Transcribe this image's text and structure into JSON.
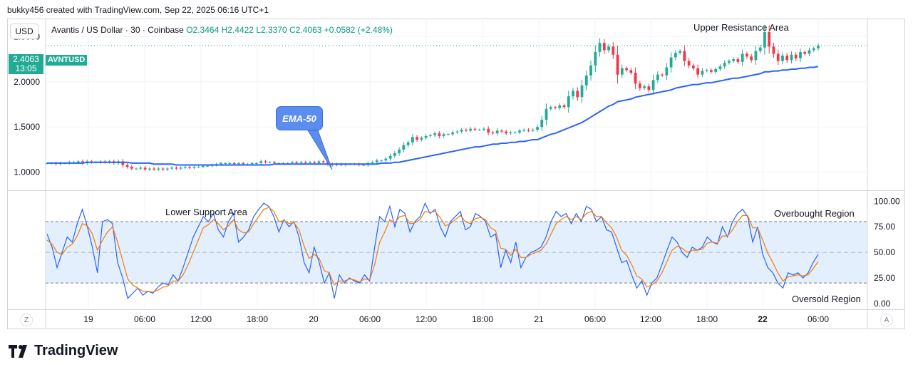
{
  "header": "bukky456 created with TradingView.com, Sep 22, 2025 06:16 UTC+1",
  "currency_button": "USD",
  "legend": {
    "symbol_desc": "Avantis / US Dollar · 30 · Coinbase",
    "open": "O2.3464",
    "high": "H2.4422",
    "low": "L2.3370",
    "close": "C2.4063",
    "change": "+0.0582 (+2.48%)"
  },
  "price_tag": {
    "value": "2.4063",
    "countdown": "13:05",
    "symbol": "AVNTUSD"
  },
  "annotations": {
    "upper": "Upper Resistance Area",
    "lower": "Lower Support Area",
    "overbought": "Overbought Region",
    "oversold": "Oversold Region",
    "ema": "EMA-50"
  },
  "corner_left": "Z",
  "corner_right": "A",
  "brand": "TradingView",
  "colors": {
    "up": "#22ab94",
    "down": "#f23645",
    "ema": "#2962ff",
    "rsi_k": "#2962ff",
    "rsi_d": "#f57c00",
    "band": "#e3effd"
  },
  "chart_data": [
    {
      "type": "candlestick",
      "ylim": [
        0.8,
        2.7
      ],
      "yticks": [
        "2.5000",
        "2.0000",
        "1.5000",
        "1.0000"
      ],
      "ytick_values": [
        2.5,
        2.0,
        1.5,
        1.0
      ],
      "close": [
        1.1,
        1.1,
        1.09,
        1.1,
        1.1,
        1.11,
        1.11,
        1.12,
        1.1,
        1.12,
        1.11,
        1.11,
        1.12,
        1.11,
        1.12,
        1.1,
        1.12,
        1.08,
        1.06,
        1.04,
        1.04,
        1.05,
        1.03,
        1.04,
        1.03,
        1.04,
        1.03,
        1.04,
        1.05,
        1.04,
        1.05,
        1.06,
        1.05,
        1.06,
        1.06,
        1.07,
        1.07,
        1.08,
        1.09,
        1.1,
        1.1,
        1.1,
        1.09,
        1.1,
        1.09,
        1.09,
        1.1,
        1.1,
        1.12,
        1.11,
        1.11,
        1.1,
        1.1,
        1.1,
        1.1,
        1.11,
        1.1,
        1.11,
        1.1,
        1.11,
        1.1,
        1.12,
        1.11,
        1.09,
        1.08,
        1.09,
        1.08,
        1.09,
        1.09,
        1.09,
        1.08,
        1.08,
        1.1,
        1.11,
        1.13,
        1.13,
        1.15,
        1.18,
        1.21,
        1.25,
        1.3,
        1.33,
        1.39,
        1.36,
        1.38,
        1.4,
        1.41,
        1.43,
        1.4,
        1.42,
        1.42,
        1.44,
        1.45,
        1.47,
        1.46,
        1.48,
        1.47,
        1.47,
        1.48,
        1.44,
        1.43,
        1.46,
        1.45,
        1.43,
        1.44,
        1.44,
        1.46,
        1.47,
        1.46,
        1.47,
        1.5,
        1.58,
        1.7,
        1.72,
        1.71,
        1.74,
        1.72,
        1.84,
        1.9,
        1.83,
        1.96,
        2.07,
        2.18,
        2.33,
        2.43,
        2.35,
        2.39,
        2.3,
        2.08,
        2.15,
        2.13,
        2.1,
        1.98,
        1.93,
        1.95,
        1.91,
        2.02,
        2.08,
        2.07,
        2.16,
        2.27,
        2.32,
        2.34,
        2.23,
        2.18,
        2.15,
        2.08,
        2.12,
        2.13,
        2.11,
        2.14,
        2.17,
        2.21,
        2.23,
        2.25,
        2.22,
        2.31,
        2.28,
        2.24,
        2.34,
        2.38,
        2.55,
        2.39,
        2.31,
        2.23,
        2.29,
        2.24,
        2.3,
        2.26,
        2.33,
        2.31,
        2.35,
        2.37,
        2.4
      ],
      "ema": [
        1.1,
        1.1,
        1.1,
        1.1,
        1.1,
        1.1,
        1.1,
        1.1,
        1.1,
        1.11,
        1.11,
        1.11,
        1.11,
        1.11,
        1.11,
        1.11,
        1.11,
        1.11,
        1.11,
        1.1,
        1.1,
        1.1,
        1.1,
        1.1,
        1.09,
        1.09,
        1.09,
        1.09,
        1.09,
        1.08,
        1.08,
        1.08,
        1.08,
        1.08,
        1.08,
        1.08,
        1.08,
        1.08,
        1.08,
        1.08,
        1.08,
        1.08,
        1.08,
        1.08,
        1.08,
        1.08,
        1.08,
        1.08,
        1.08,
        1.08,
        1.08,
        1.09,
        1.09,
        1.09,
        1.09,
        1.09,
        1.09,
        1.09,
        1.09,
        1.09,
        1.09,
        1.09,
        1.09,
        1.09,
        1.09,
        1.09,
        1.09,
        1.09,
        1.09,
        1.09,
        1.09,
        1.09,
        1.09,
        1.09,
        1.09,
        1.1,
        1.1,
        1.1,
        1.11,
        1.11,
        1.12,
        1.13,
        1.14,
        1.15,
        1.16,
        1.17,
        1.18,
        1.19,
        1.2,
        1.21,
        1.22,
        1.23,
        1.24,
        1.25,
        1.26,
        1.27,
        1.28,
        1.28,
        1.29,
        1.3,
        1.31,
        1.31,
        1.32,
        1.32,
        1.33,
        1.33,
        1.34,
        1.34,
        1.35,
        1.36,
        1.36,
        1.38,
        1.4,
        1.42,
        1.43,
        1.45,
        1.47,
        1.49,
        1.51,
        1.53,
        1.55,
        1.58,
        1.61,
        1.64,
        1.67,
        1.7,
        1.73,
        1.75,
        1.78,
        1.79,
        1.8,
        1.81,
        1.83,
        1.84,
        1.85,
        1.86,
        1.87,
        1.88,
        1.89,
        1.9,
        1.91,
        1.93,
        1.94,
        1.95,
        1.96,
        1.97,
        1.97,
        1.98,
        1.99,
        1.99,
        2.0,
        2.01,
        2.02,
        2.03,
        2.04,
        2.04,
        2.05,
        2.06,
        2.07,
        2.08,
        2.09,
        2.11,
        2.11,
        2.12,
        2.12,
        2.13,
        2.13,
        2.14,
        2.14,
        2.15,
        2.15,
        2.16,
        2.16,
        2.17
      ]
    },
    {
      "type": "line",
      "ylim": [
        -5,
        110
      ],
      "yticks": [
        "100.00",
        "75.00",
        "50.00",
        "25.00",
        "0.00"
      ],
      "ytick_values": [
        100,
        75,
        50,
        25,
        0
      ],
      "band": [
        20,
        80
      ],
      "midline": 50,
      "series": [
        {
          "values": [
            68,
            55,
            35,
            50,
            65,
            60,
            78,
            92,
            75,
            55,
            30,
            80,
            82,
            78,
            40,
            25,
            5,
            10,
            15,
            8,
            12,
            10,
            16,
            20,
            18,
            28,
            22,
            35,
            50,
            65,
            75,
            85,
            80,
            88,
            72,
            65,
            80,
            88,
            60,
            65,
            72,
            85,
            92,
            98,
            95,
            85,
            70,
            82,
            75,
            80,
            65,
            40,
            30,
            55,
            40,
            20,
            30,
            5,
            28,
            20,
            25,
            22,
            20,
            28,
            22,
            55,
            85,
            80,
            95,
            75,
            92,
            88,
            70,
            80,
            85,
            98,
            88,
            92,
            75,
            65,
            80,
            85,
            90,
            72,
            75,
            88,
            85,
            80,
            65,
            68,
            35,
            52,
            40,
            60,
            35,
            45,
            50,
            52,
            55,
            65,
            80,
            90,
            85,
            88,
            78,
            88,
            80,
            95,
            92,
            80,
            85,
            72,
            70,
            55,
            40,
            42,
            28,
            15,
            22,
            8,
            20,
            25,
            38,
            52,
            65,
            60,
            50,
            45,
            55,
            52,
            55,
            65,
            60,
            58,
            75,
            65,
            80,
            88,
            92,
            85,
            60,
            75,
            48,
            35,
            30,
            20,
            15,
            30,
            28,
            30,
            25,
            30,
            40,
            48
          ]
        },
        {
          "values": [
            62,
            58,
            50,
            48,
            55,
            58,
            66,
            78,
            76,
            68,
            52,
            62,
            70,
            75,
            60,
            42,
            24,
            18,
            15,
            12,
            12,
            11,
            13,
            16,
            17,
            22,
            22,
            28,
            38,
            50,
            62,
            74,
            77,
            82,
            78,
            72,
            76,
            82,
            72,
            69,
            70,
            78,
            85,
            92,
            94,
            90,
            80,
            81,
            78,
            79,
            72,
            56,
            44,
            48,
            44,
            32,
            30,
            18,
            22,
            22,
            24,
            23,
            21,
            24,
            23,
            38,
            60,
            70,
            82,
            79,
            85,
            86,
            78,
            79,
            82,
            90,
            89,
            90,
            84,
            76,
            78,
            82,
            86,
            80,
            78,
            83,
            84,
            82,
            74,
            71,
            54,
            53,
            47,
            53,
            45,
            45,
            48,
            50,
            52,
            58,
            68,
            78,
            82,
            85,
            82,
            85,
            82,
            88,
            90,
            85,
            85,
            79,
            74,
            65,
            52,
            47,
            38,
            27,
            24,
            16,
            18,
            22,
            30,
            41,
            52,
            56,
            54,
            50,
            52,
            52,
            53,
            59,
            60,
            59,
            66,
            66,
            72,
            80,
            86,
            86,
            74,
            74,
            62,
            49,
            40,
            30,
            22,
            26,
            27,
            28,
            27,
            28,
            34,
            41
          ]
        }
      ]
    }
  ],
  "x_axis": [
    "19",
    "06:00",
    "12:00",
    "18:00",
    "20",
    "06:00",
    "12:00",
    "18:00",
    "21",
    "06:00",
    "12:00",
    "18:00",
    "22",
    "06:00"
  ]
}
